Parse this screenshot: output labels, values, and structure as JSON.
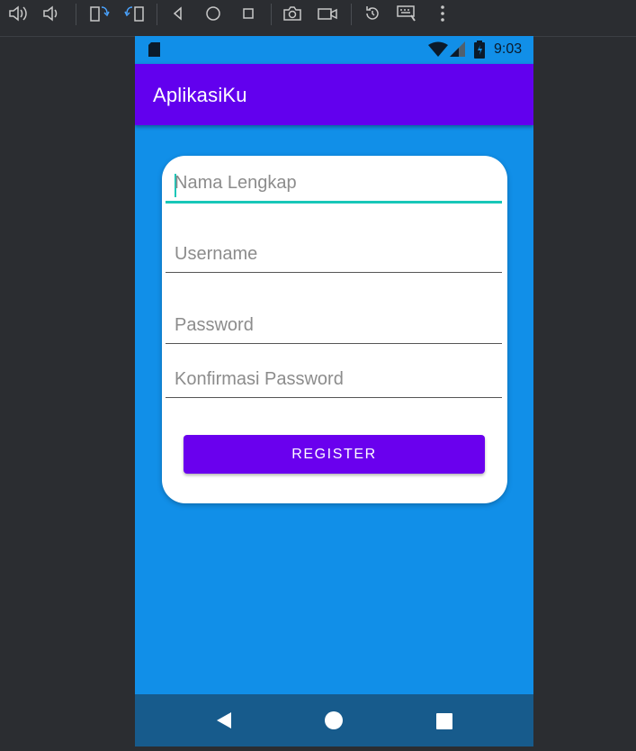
{
  "statusbar": {
    "time": "9:03"
  },
  "appbar": {
    "title": "AplikasiKu"
  },
  "form": {
    "fields": [
      {
        "placeholder": "Nama Lengkap",
        "value": ""
      },
      {
        "placeholder": "Username",
        "value": ""
      },
      {
        "placeholder": "Password",
        "value": ""
      },
      {
        "placeholder": "Konfirmasi Password",
        "value": ""
      }
    ],
    "register_label": "REGISTER"
  },
  "colors": {
    "background": "#118fe8",
    "appbar": "#6200ee",
    "button": "#6a00ee",
    "focus_accent": "#18c7b8",
    "navbar": "#175b8c"
  },
  "icons": {
    "toolbar": [
      "volume-up-icon",
      "volume-down-icon",
      "rotate-left-icon",
      "rotate-right-icon",
      "back-icon",
      "home-icon",
      "overview-icon",
      "screenshot-icon",
      "screen-record-icon",
      "resume-icon",
      "keyboard-icon",
      "more-icon"
    ],
    "statusbar": [
      "sd-card-icon",
      "wifi-icon",
      "signal-icon",
      "battery-icon"
    ],
    "navbar": [
      "nav-back-icon",
      "nav-home-icon",
      "nav-recents-icon"
    ]
  }
}
